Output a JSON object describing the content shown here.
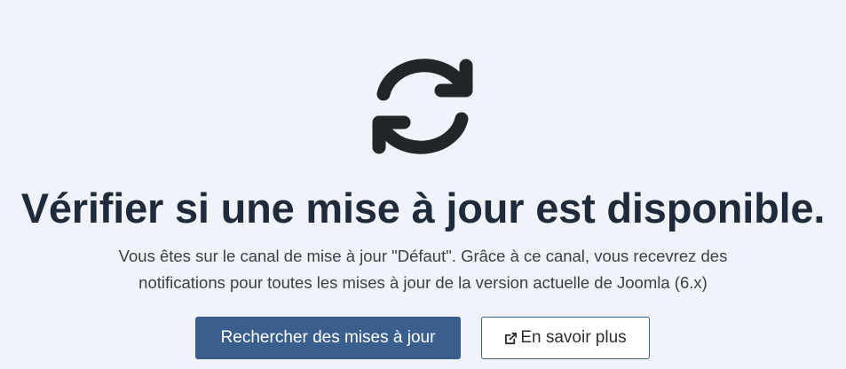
{
  "icons": {
    "main": "sync-icon",
    "learn_more": "external-link-icon"
  },
  "header": {
    "title": "Vérifier si une mise à jour est disponible."
  },
  "description": {
    "line1": "Vous êtes sur le canal de mise à jour \"Défaut\". Grâce à ce canal, vous recevrez des",
    "line2": "notifications pour toutes les mises à jour de la version actuelle de Joomla (6.x)"
  },
  "actions": {
    "check_label": "Rechercher des mises à jour",
    "learn_more_label": "En savoir plus"
  },
  "colors": {
    "background": "#f0f4fa",
    "primary": "#3a5f8d",
    "title": "#1f2a3b",
    "icon": "#22262a"
  }
}
